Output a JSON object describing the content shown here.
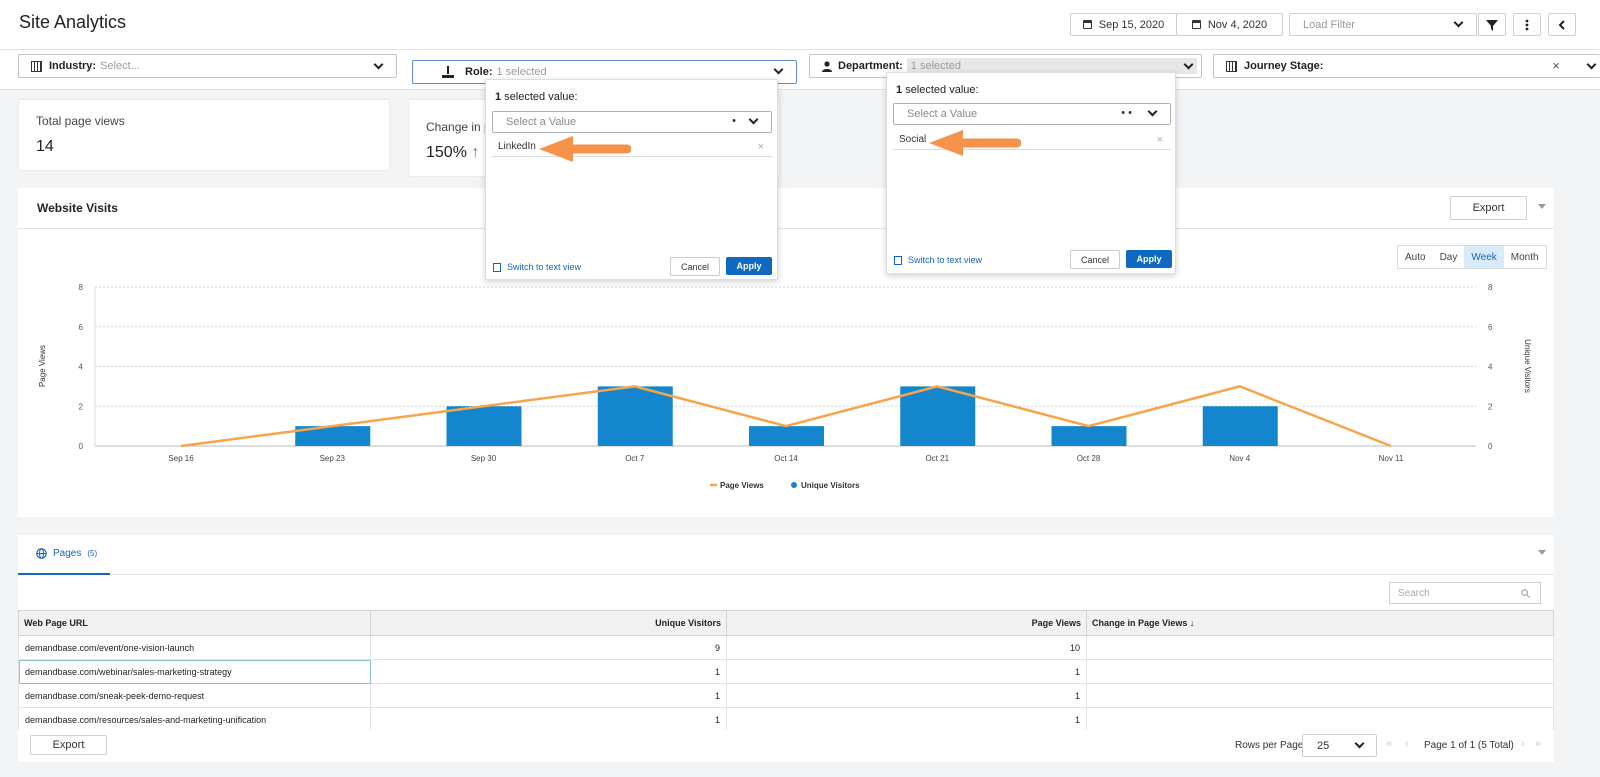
{
  "header": {
    "title": "Site Analytics",
    "start_date": "Sep 15, 2020",
    "end_date": "Nov 4, 2020",
    "load_filter_placeholder": "Load Filter"
  },
  "filters": {
    "industry": {
      "label": "Industry:",
      "value": "Select..."
    },
    "role": {
      "label": "Role:",
      "value": "1 selected"
    },
    "department": {
      "label": "Department:",
      "value": "1 selected"
    },
    "journey": {
      "label": "Journey Stage:",
      "value": ""
    }
  },
  "role_dropdown": {
    "count": "1",
    "header": "selected value:",
    "placeholder": "Select a Value",
    "item": "LinkedIn",
    "switch_link": "Switch to text view",
    "cancel": "Cancel",
    "apply": "Apply"
  },
  "department_dropdown": {
    "count": "1",
    "header": "selected value:",
    "placeholder": "Select a Value",
    "item": "Social",
    "switch_link": "Switch to text view",
    "cancel": "Cancel",
    "apply": "Apply"
  },
  "kpis": {
    "total_label": "Total page views",
    "total_value": "14",
    "change_label": "Change in p",
    "change_value": "150%",
    "change_arrow": "↑"
  },
  "website_visits": {
    "title": "Website Visits",
    "export": "Export",
    "granularity": [
      "Auto",
      "Day",
      "Week",
      "Month"
    ],
    "selected_granularity": "Week"
  },
  "chart_data": {
    "type": "bar",
    "categories": [
      "Sep 16",
      "Sep 23",
      "Sep 30",
      "Oct 7",
      "Oct 14",
      "Oct 21",
      "Oct 28",
      "Nov 4",
      "Nov 11"
    ],
    "series": [
      {
        "name": "Page Views",
        "type": "line",
        "color": "#f7a44a",
        "values": [
          0,
          1,
          2,
          3,
          1,
          3,
          1,
          3,
          0
        ]
      },
      {
        "name": "Unique Visitors",
        "type": "bar",
        "color": "#1386cd",
        "values": [
          0,
          1,
          2,
          3,
          1,
          3,
          1,
          2,
          0
        ]
      }
    ],
    "ylabel": "Page Views",
    "y2label": "Unique Visitors",
    "ylim": [
      0,
      8
    ],
    "yticks": [
      0,
      2,
      4,
      6,
      8
    ],
    "grid": true,
    "legend": "bottom-center"
  },
  "pages": {
    "tab_label": "Pages",
    "tab_count": "(5)",
    "search_placeholder": "Search",
    "columns": [
      "Web Page URL",
      "Unique Visitors",
      "Page Views",
      "Change in Page Views ↓"
    ],
    "rows": [
      [
        "demandbase.com/event/one-vision-launch",
        "9",
        "10",
        ""
      ],
      [
        "demandbase.com/webinar/sales-marketing-strategy",
        "1",
        "1",
        ""
      ],
      [
        "demandbase.com/sneak-peek-demo-request",
        "1",
        "1",
        ""
      ],
      [
        "demandbase.com/resources/sales-and-marketing-unification",
        "1",
        "1",
        ""
      ]
    ],
    "export": "Export",
    "rows_per_page_label": "Rows per Page:",
    "rows_per_page": "25",
    "pagination": "Page 1 of 1 (5 Total)"
  },
  "colors": {
    "accent": "#0d6ac0",
    "bar": "#1386cd",
    "line": "#f7a44a",
    "callout_arrow": "#f5934a",
    "positive": "#2e9e3e"
  }
}
